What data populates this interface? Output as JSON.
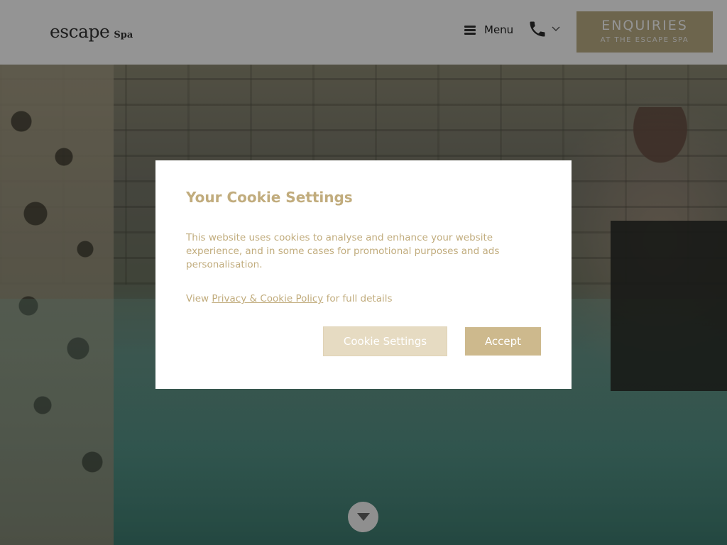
{
  "header": {
    "logo_word": "escape",
    "logo_sub": "Spa",
    "menu_label": "Menu",
    "phone_icon": "phone-icon",
    "enquiries_title": "ENQUIRIES",
    "enquiries_subtitle": "AT THE ESCAPE SPA"
  },
  "cookie_modal": {
    "title": "Your Cookie Settings",
    "description": "This website uses cookies to analyse and enhance your website experience, and in some cases for promotional purposes and ads personalisation.",
    "policy_prefix": "View",
    "policy_link": "Privacy & Cookie Policy",
    "policy_suffix": "for full details",
    "settings_button": "Cookie Settings",
    "accept_button": "Accept"
  },
  "colors": {
    "accent": "#c1ac7d",
    "accept_bg": "#cdb98d",
    "settings_bg": "#e6dbc2",
    "enquiries_bg": "#bcae86"
  },
  "icons": {
    "scroll": "chevron-down-icon",
    "menu": "hamburger-icon"
  }
}
